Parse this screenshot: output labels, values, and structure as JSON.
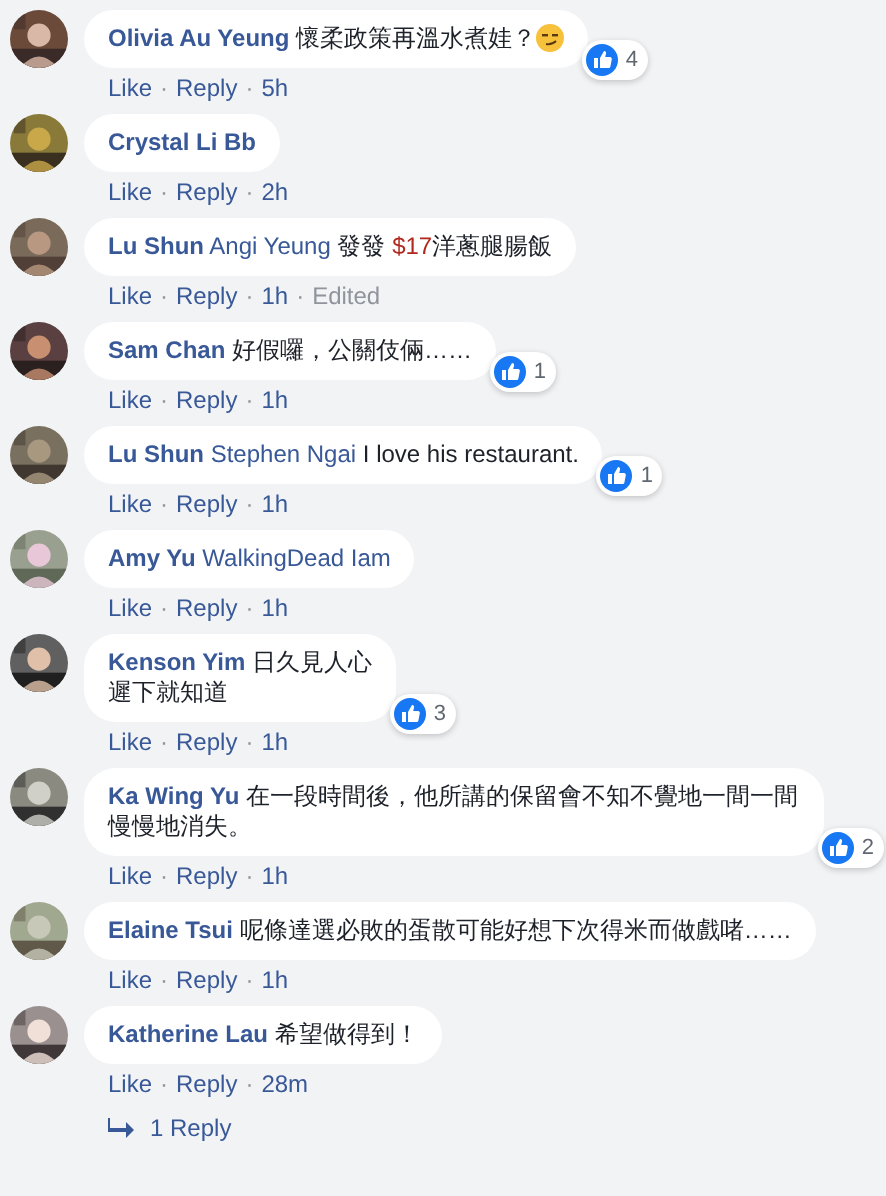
{
  "comments": [
    {
      "author": "Olivia Au Yeung",
      "body": [
        {
          "kind": "plain",
          "text": "懷柔政策再溫水煮娃？"
        },
        {
          "kind": "emoji"
        }
      ],
      "reactions": "4",
      "meta": [
        {
          "kind": "action",
          "text": "Like"
        },
        {
          "kind": "sep",
          "text": "·"
        },
        {
          "kind": "action",
          "text": "Reply"
        },
        {
          "kind": "sep",
          "text": "·"
        },
        {
          "kind": "time",
          "text": "5h"
        }
      ]
    },
    {
      "author": "Crystal Li Bb",
      "meta": [
        {
          "kind": "action",
          "text": "Like"
        },
        {
          "kind": "sep",
          "text": "·"
        },
        {
          "kind": "action",
          "text": "Reply"
        },
        {
          "kind": "sep",
          "text": "·"
        },
        {
          "kind": "time",
          "text": "2h"
        }
      ]
    },
    {
      "author": "Lu Shun",
      "body": [
        {
          "kind": "mention",
          "text": "Angi Yeung"
        },
        {
          "kind": "plain",
          "text": " 發發 "
        },
        {
          "kind": "price",
          "text": "$17"
        },
        {
          "kind": "plain",
          "text": "洋蔥腿腸飯"
        }
      ],
      "meta": [
        {
          "kind": "action",
          "text": "Like"
        },
        {
          "kind": "sep",
          "text": "·"
        },
        {
          "kind": "action",
          "text": "Reply"
        },
        {
          "kind": "sep",
          "text": "·"
        },
        {
          "kind": "time",
          "text": "1h"
        },
        {
          "kind": "sep",
          "text": "·"
        },
        {
          "kind": "note",
          "text": "Edited"
        }
      ]
    },
    {
      "author": "Sam Chan",
      "body": [
        {
          "kind": "plain",
          "text": "好假囉，公關伎倆……"
        }
      ],
      "reactions": "1",
      "meta": [
        {
          "kind": "action",
          "text": "Like"
        },
        {
          "kind": "sep",
          "text": "·"
        },
        {
          "kind": "action",
          "text": "Reply"
        },
        {
          "kind": "sep",
          "text": "·"
        },
        {
          "kind": "time",
          "text": "1h"
        }
      ]
    },
    {
      "author": "Lu Shun",
      "body": [
        {
          "kind": "mention",
          "text": "Stephen Ngai"
        },
        {
          "kind": "plain",
          "text": " I love his restaurant."
        }
      ],
      "reactions": "1",
      "meta": [
        {
          "kind": "action",
          "text": "Like"
        },
        {
          "kind": "sep",
          "text": "·"
        },
        {
          "kind": "action",
          "text": "Reply"
        },
        {
          "kind": "sep",
          "text": "·"
        },
        {
          "kind": "time",
          "text": "1h"
        }
      ]
    },
    {
      "author": "Amy Yu",
      "body": [
        {
          "kind": "mention",
          "text": "WalkingDead Iam"
        }
      ],
      "meta": [
        {
          "kind": "action",
          "text": "Like"
        },
        {
          "kind": "sep",
          "text": "·"
        },
        {
          "kind": "action",
          "text": "Reply"
        },
        {
          "kind": "sep",
          "text": "·"
        },
        {
          "kind": "time",
          "text": "1h"
        }
      ]
    },
    {
      "author": "Kenson Yim",
      "body": [
        {
          "kind": "plain",
          "text": "日久見人心"
        },
        {
          "kind": "break"
        },
        {
          "kind": "plain",
          "text": "遲下就知道"
        }
      ],
      "reactions": "3",
      "meta": [
        {
          "kind": "action",
          "text": "Like"
        },
        {
          "kind": "sep",
          "text": "·"
        },
        {
          "kind": "action",
          "text": "Reply"
        },
        {
          "kind": "sep",
          "text": "·"
        },
        {
          "kind": "time",
          "text": "1h"
        }
      ]
    },
    {
      "author": "Ka Wing Yu",
      "body": [
        {
          "kind": "plain",
          "text": "在一段時間後，他所講的保留會不知不覺地一間一間慢慢地消失。"
        }
      ],
      "reactions": "2",
      "meta": [
        {
          "kind": "action",
          "text": "Like"
        },
        {
          "kind": "sep",
          "text": "·"
        },
        {
          "kind": "action",
          "text": "Reply"
        },
        {
          "kind": "sep",
          "text": "·"
        },
        {
          "kind": "time",
          "text": "1h"
        }
      ]
    },
    {
      "author": "Elaine Tsui",
      "body": [
        {
          "kind": "plain",
          "text": "呢條達選必敗的蛋散可能好想下次得米而做戲啫……"
        }
      ],
      "meta": [
        {
          "kind": "action",
          "text": "Like"
        },
        {
          "kind": "sep",
          "text": "·"
        },
        {
          "kind": "action",
          "text": "Reply"
        },
        {
          "kind": "sep",
          "text": "·"
        },
        {
          "kind": "time",
          "text": "1h"
        }
      ]
    },
    {
      "author": "Katherine Lau",
      "body": [
        {
          "kind": "plain",
          "text": "希望做得到！"
        }
      ],
      "meta": [
        {
          "kind": "action",
          "text": "Like"
        },
        {
          "kind": "sep",
          "text": "·"
        },
        {
          "kind": "action",
          "text": "Reply"
        },
        {
          "kind": "sep",
          "text": "·"
        },
        {
          "kind": "time",
          "text": "28m"
        }
      ]
    }
  ],
  "replies_link": "1 Reply"
}
